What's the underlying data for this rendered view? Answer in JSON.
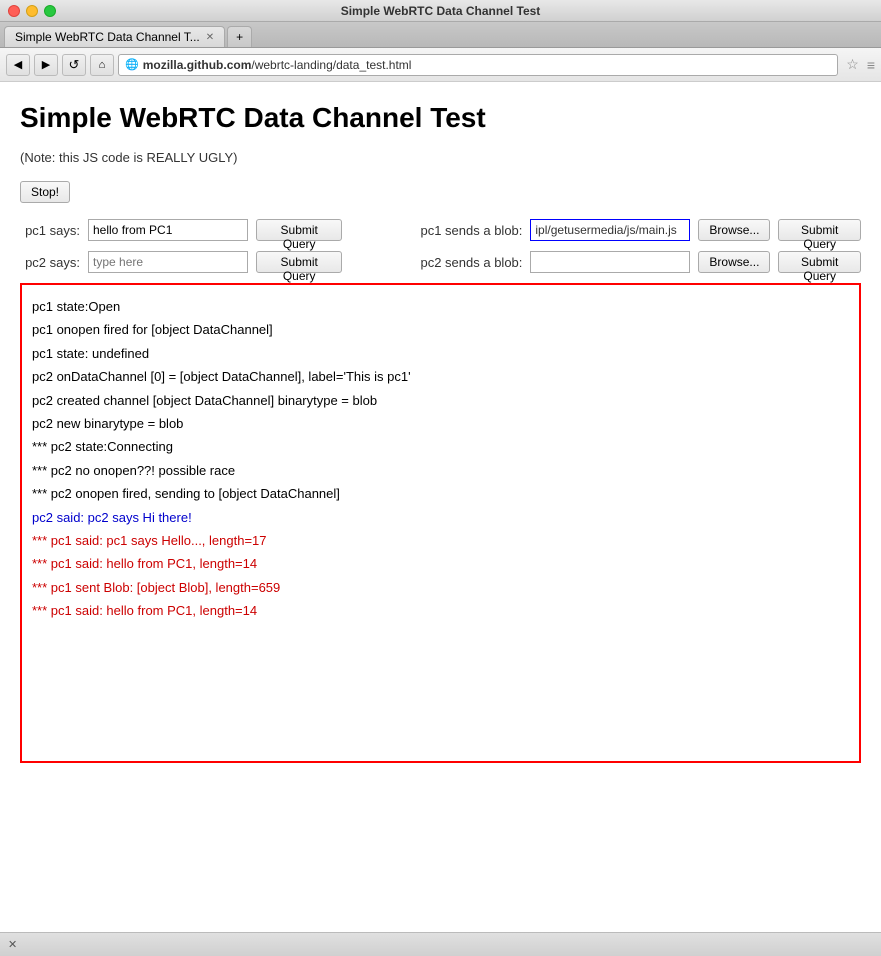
{
  "window": {
    "title": "Simple WebRTC Data Channel Test",
    "tab_label": "Simple WebRTC Data Channel T...",
    "tab_add": "+"
  },
  "nav": {
    "back_icon": "◀",
    "forward_icon": "▶",
    "reload_icon": "↺",
    "home_icon": "⌂",
    "address": "mozilla.github.com/webrtc-landing/data_test.html",
    "address_domain": "mozilla.github.com",
    "address_path": "/webrtc-landing/data_test.html",
    "bookmark_icon": "☆",
    "nav_icon": "≡"
  },
  "page": {
    "title": "Simple WebRTC Data Channel Test",
    "note": "(Note: this JS code is REALLY UGLY)",
    "stop_button": "Stop!",
    "pc1_label": "pc1 says:",
    "pc1_value": "hello from PC1",
    "pc1_submit": "Submit Query",
    "pc1_blob_label": "pc1 sends a blob:",
    "pc1_blob_value": "ipl/getusermedia/js/main.js",
    "pc1_blob_browse": "Browse...",
    "pc1_blob_submit": "Submit Query",
    "pc2_label": "pc2 says:",
    "pc2_value": "type here",
    "pc2_submit": "Submit Query",
    "pc2_blob_label": "pc2 sends a blob:",
    "pc2_blob_value": "",
    "pc2_blob_browse": "Browse...",
    "pc2_blob_submit": "Submit Query"
  },
  "log": {
    "lines": [
      {
        "text": "pc1 state:Open",
        "color": "black"
      },
      {
        "text": "pc1 onopen fired for [object DataChannel]",
        "color": "black"
      },
      {
        "text": "pc1 state: undefined",
        "color": "black"
      },
      {
        "text": "pc2 onDataChannel [0] = [object DataChannel], label='This is pc1'",
        "color": "black"
      },
      {
        "text": "pc2 created channel [object DataChannel] binarytype = blob",
        "color": "black"
      },
      {
        "text": "pc2 new binarytype = blob",
        "color": "black"
      },
      {
        "text": "*** pc2 state:Connecting",
        "color": "black"
      },
      {
        "text": "*** pc2 no onopen??! possible race",
        "color": "black"
      },
      {
        "text": "*** pc2 onopen fired, sending to [object DataChannel]",
        "color": "black"
      },
      {
        "text": "pc2 said: pc2 says Hi there!",
        "color": "blue"
      },
      {
        "text": "*** pc1 said: pc1 says Hello..., length=17",
        "color": "red"
      },
      {
        "text": "*** pc1 said: hello from PC1, length=14",
        "color": "red"
      },
      {
        "text": "*** pc1 sent Blob: [object Blob], length=659",
        "color": "red"
      },
      {
        "text": "*** pc1 said: hello from PC1, length=14",
        "color": "red"
      }
    ]
  },
  "status": {
    "text": "✕"
  }
}
